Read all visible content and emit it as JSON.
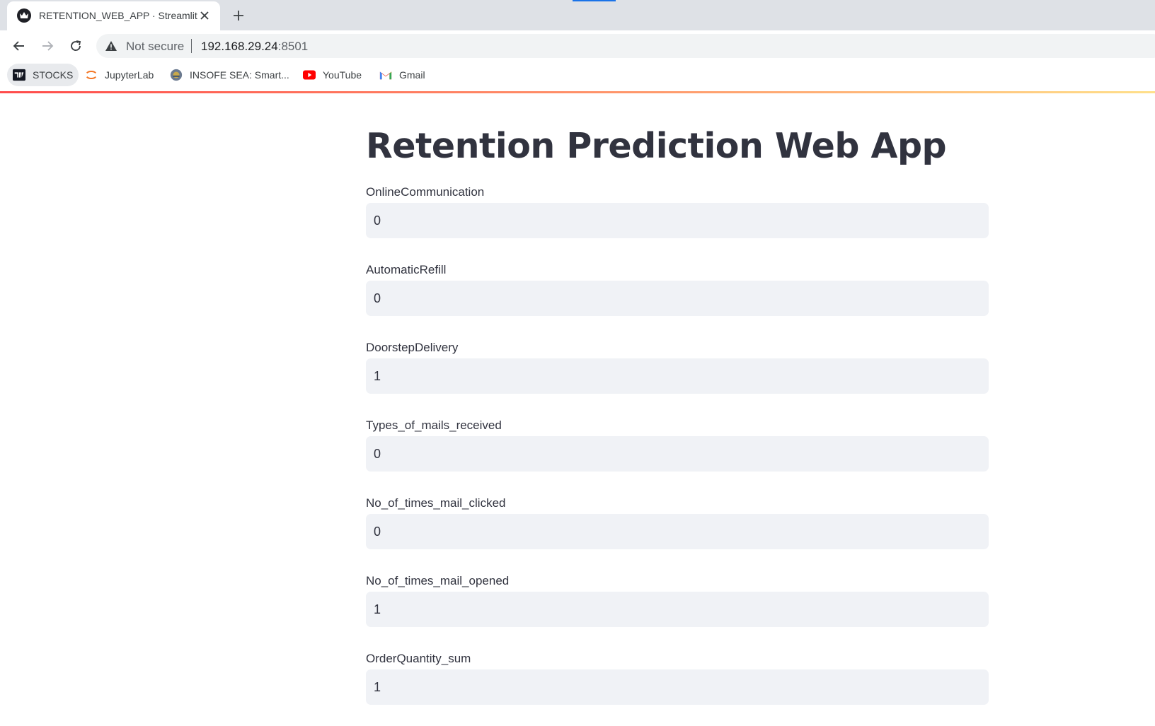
{
  "browser": {
    "tab": {
      "title": "RETENTION_WEB_APP · Streamlit"
    },
    "address": {
      "security_label": "Not secure",
      "host": "192.168.29.24",
      "port": ":8501"
    },
    "bookmarks": [
      {
        "label": "STOCKS",
        "icon": "tradingview-icon"
      },
      {
        "label": "JupyterLab",
        "icon": "jupyter-icon"
      },
      {
        "label": "INSOFE SEA: Smart...",
        "icon": "insofe-icon"
      },
      {
        "label": "YouTube",
        "icon": "youtube-icon"
      },
      {
        "label": "Gmail",
        "icon": "gmail-icon"
      }
    ]
  },
  "app": {
    "title": "Retention Prediction Web App",
    "fields": [
      {
        "label": "OnlineCommunication",
        "value": "0"
      },
      {
        "label": "AutomaticRefill",
        "value": "0"
      },
      {
        "label": "DoorstepDelivery",
        "value": "1"
      },
      {
        "label": "Types_of_mails_received",
        "value": "0"
      },
      {
        "label": "No_of_times_mail_clicked",
        "value": "0"
      },
      {
        "label": "No_of_times_mail_opened",
        "value": "1"
      },
      {
        "label": "OrderQuantity_sum",
        "value": "1"
      }
    ]
  }
}
